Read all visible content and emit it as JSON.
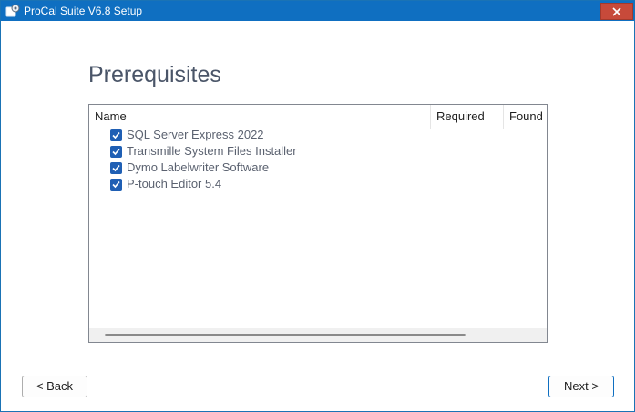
{
  "window": {
    "title": "ProCal Suite V6.8 Setup",
    "close_label": "✕"
  },
  "page": {
    "title": "Prerequisites"
  },
  "list": {
    "columns": [
      "Name",
      "Required",
      "Found"
    ],
    "items": [
      {
        "label": "SQL Server Express 2022",
        "checked": true
      },
      {
        "label": "Transmille System Files Installer",
        "checked": true
      },
      {
        "label": "Dymo Labelwriter Software",
        "checked": true
      },
      {
        "label": "P-touch Editor 5.4",
        "checked": true
      }
    ]
  },
  "buttons": {
    "back_label": "< Back",
    "next_label": "Next >"
  },
  "colors": {
    "titlebar": "#0f6fc1",
    "close": "#c74a3a",
    "checkbox": "#1f5fb4"
  }
}
